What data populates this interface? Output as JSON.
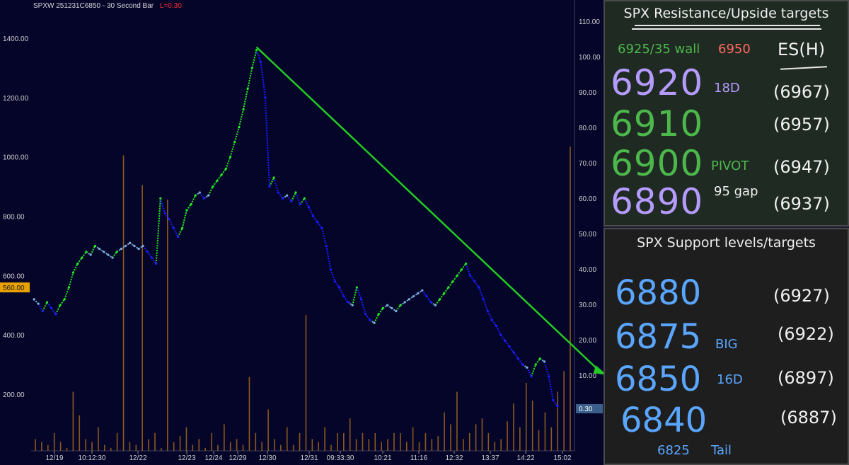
{
  "chart_title": "SPXW 251231C6850 - 30 Second Bar",
  "last_label": "L=0.30",
  "left_axis": {
    "ticks": [
      "1400.00",
      "1200.00",
      "1000.00",
      "800.00",
      "600.00",
      "400.00",
      "200.00"
    ],
    "price_tag": "560.00"
  },
  "right_axis": {
    "ticks": [
      "110.00",
      "100.00",
      "90.00",
      "80.00",
      "70.00",
      "60.00",
      "50.00",
      "40.00",
      "30.00",
      "20.00",
      "10.00"
    ],
    "price_tag": "0.30"
  },
  "x_axis": {
    "ticks": [
      "12/19",
      "10:12:30",
      "12/22",
      "12/23",
      "12/24",
      "12/29",
      "12/30",
      "12/31",
      "09:33:30",
      "10:21",
      "11:16",
      "12:32",
      "13:37",
      "14:22",
      "15:02"
    ]
  },
  "colors": {
    "bg": "#05052a",
    "up": "#22ee22",
    "mid": "#7fb0e0",
    "down": "#1a1aff",
    "volume": "#8a5a1a",
    "arrow": "#22cc22"
  },
  "chart_data": {
    "type": "line",
    "title": "SPXW 251231C6850 - 30 Second Bar",
    "ylim_left": [
      100,
      1450
    ],
    "ylim_right": [
      0,
      110
    ],
    "series": [
      {
        "values": [
          520,
          505,
          480,
          510,
          490,
          470,
          500,
          520,
          560,
          610,
          640,
          660,
          680,
          670,
          700,
          690,
          680,
          670,
          660,
          680,
          690,
          700,
          710,
          700,
          690,
          700,
          680,
          660,
          640,
          860,
          810,
          790,
          760,
          730,
          760,
          820,
          840,
          870,
          880,
          860,
          870,
          900,
          920,
          940,
          960,
          1000,
          1050,
          1100,
          1160,
          1230,
          1300,
          1360,
          1320,
          1200,
          900,
          930,
          880,
          860,
          870,
          850,
          880,
          840,
          860,
          830,
          800,
          780,
          760,
          700,
          620,
          580,
          560,
          530,
          510,
          500,
          560,
          520,
          470,
          450,
          440,
          470,
          490,
          500,
          490,
          480,
          500,
          510,
          520,
          530,
          540,
          550,
          530,
          510,
          500,
          520,
          540,
          560,
          580,
          600,
          620,
          640,
          600,
          580,
          560,
          520,
          480,
          450,
          430,
          400,
          380,
          360,
          340,
          320,
          300,
          290,
          260,
          300,
          320,
          310,
          260,
          180,
          160
        ]
      }
    ],
    "volume": [
      40,
      30,
      20,
      60,
      30,
      10,
      200,
      120,
      40,
      30,
      80,
      20,
      10,
      60,
      1000,
      30,
      20,
      900,
      40,
      60,
      10,
      850,
      30,
      50,
      80,
      20,
      40,
      10,
      60,
      20,
      90,
      30,
      40,
      20,
      250,
      60,
      30,
      140,
      40,
      20,
      80,
      20,
      60,
      460,
      40,
      30,
      80,
      20,
      60,
      60,
      110,
      40,
      60,
      40,
      60,
      30,
      40,
      60,
      60,
      30,
      80,
      30,
      60,
      40,
      50,
      130,
      90,
      200,
      40,
      60,
      90,
      110,
      60,
      30,
      40,
      100,
      160,
      80,
      230,
      170,
      70,
      130,
      80,
      200,
      270,
      1030
    ],
    "trendline": {
      "from_value": 1370,
      "to_right_value": 10.0
    }
  },
  "resistance": {
    "title": "SPX Resistance/Upside targets",
    "wall_label": "6925/35 wall",
    "wall_value": "6950",
    "es_label": "ES(H)",
    "levels": [
      {
        "value": "6920",
        "tag": "18D",
        "es": "(6967)",
        "color": "#b59bff"
      },
      {
        "value": "6910",
        "tag": "",
        "es": "(6957)",
        "color": "#4cb84c"
      },
      {
        "value": "6900",
        "tag": "PIVOT",
        "es": "(6947)",
        "color": "#4cb84c"
      },
      {
        "value": "6890",
        "tag": "95 gap",
        "es": "(6937)",
        "color": "#b59bff"
      }
    ]
  },
  "support": {
    "title": "SPX Support levels/targets",
    "levels": [
      {
        "value": "6880",
        "tag": "",
        "es": "(6927)"
      },
      {
        "value": "6875",
        "tag": "BIG",
        "es": "(6922)"
      },
      {
        "value": "6850",
        "tag": "16D",
        "es": "(6897)"
      },
      {
        "value": "6840",
        "tag": "",
        "es": "(6887)"
      }
    ],
    "tail_value": "6825",
    "tail_label": "Tail"
  }
}
